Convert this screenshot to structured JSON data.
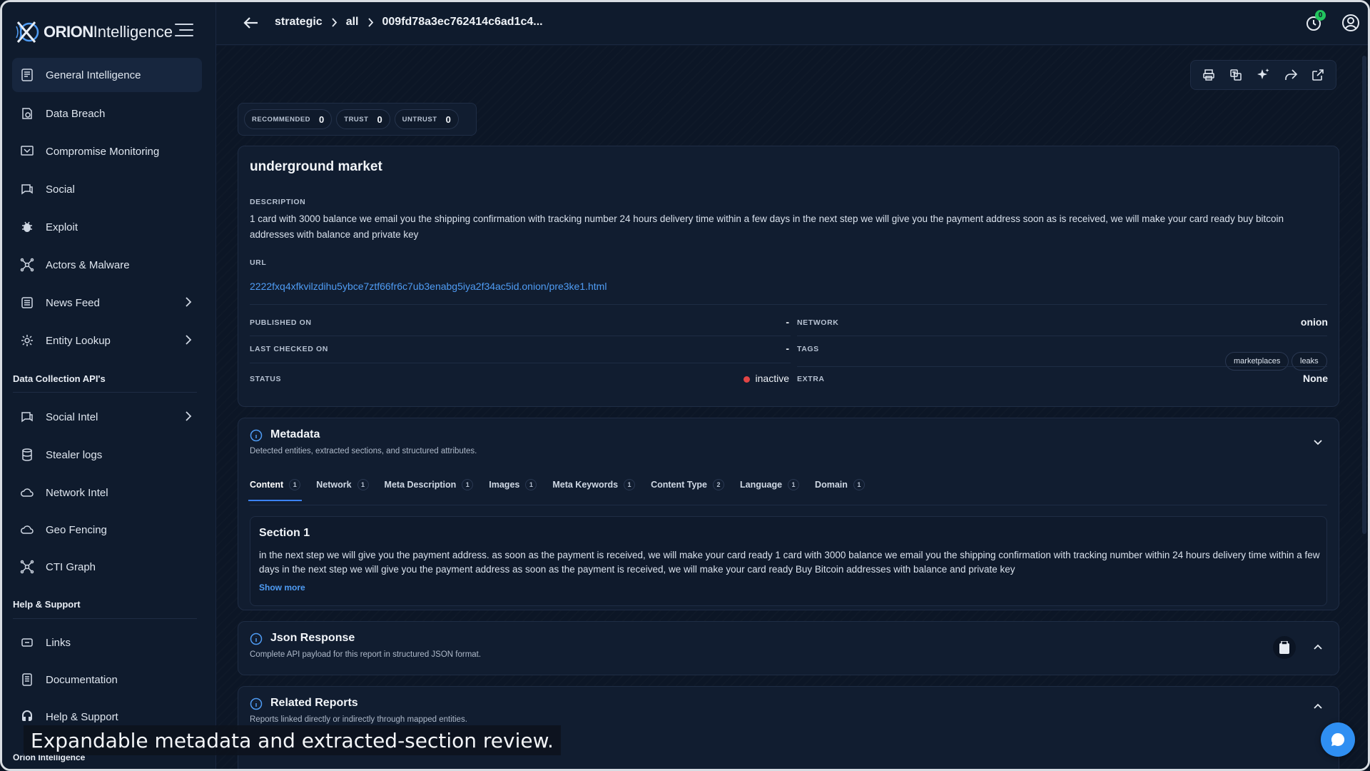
{
  "brand": {
    "bold": "ORION",
    "light": "Intelligence"
  },
  "sidebar": {
    "items": [
      {
        "label": "General Intelligence",
        "icon": "news-icon",
        "active": true
      },
      {
        "label": "Data Breach",
        "icon": "breach-icon"
      },
      {
        "label": "Compromise Monitoring",
        "icon": "monitor-icon"
      },
      {
        "label": "Social",
        "icon": "chat-icon"
      },
      {
        "label": "Exploit",
        "icon": "bug-icon"
      },
      {
        "label": "Actors & Malware",
        "icon": "network-icon"
      },
      {
        "label": "News Feed",
        "icon": "newspaper-icon",
        "expandable": true
      },
      {
        "label": "Entity Lookup",
        "icon": "gear-icon",
        "expandable": true
      }
    ],
    "section_api": "Data Collection API's",
    "api_items": [
      {
        "label": "Social Intel",
        "icon": "chat-icon",
        "expandable": true
      },
      {
        "label": "Stealer logs",
        "icon": "database-icon"
      },
      {
        "label": "Network Intel",
        "icon": "cloud-icon"
      },
      {
        "label": "Geo Fencing",
        "icon": "cloud-icon"
      },
      {
        "label": "CTI Graph",
        "icon": "graph-icon"
      }
    ],
    "section_help": "Help & Support",
    "help_items": [
      {
        "label": "Links",
        "icon": "link-icon"
      },
      {
        "label": "Documentation",
        "icon": "document-icon"
      },
      {
        "label": "Help & Support",
        "icon": "support-icon"
      }
    ],
    "footer": "Orion Intelligence"
  },
  "topbar": {
    "breadcrumbs": [
      "strategic",
      "all",
      "009fd78a3ec762414c6ad1c4..."
    ],
    "notification_count": "0"
  },
  "stats": [
    {
      "label": "RECOMMENDED",
      "value": "0"
    },
    {
      "label": "TRUST",
      "value": "0"
    },
    {
      "label": "UNTRUST",
      "value": "0"
    }
  ],
  "report": {
    "title": "underground market",
    "description_label": "DESCRIPTION",
    "description": "1 card with 3000 balance we email you the shipping confirmation with tracking number 24 hours delivery time within a few days in the next step we will give you the payment address soon as is received, we will make your card ready buy bitcoin addresses with balance and private key",
    "url_label": "URL",
    "url": "2222fxq4xfkvilzdihu5ybce7ztf66fr6c7ub3enabg5iya2f34ac5id.onion/pre3ke1.html",
    "published_label": "PUBLISHED ON",
    "published": "-",
    "last_checked_label": "LAST CHECKED ON",
    "last_checked": "-",
    "status_label": "STATUS",
    "status": "inactive",
    "status_color": "#e24545",
    "network_label": "NETWORK",
    "network": "onion",
    "tags_label": "TAGS",
    "tags": [
      "marketplaces",
      "leaks"
    ],
    "extra_label": "EXTRA",
    "extra": "None"
  },
  "metadata": {
    "title": "Metadata",
    "subtitle": "Detected entities, extracted sections, and structured attributes.",
    "tabs": [
      {
        "label": "Content",
        "count": "1",
        "active": true
      },
      {
        "label": "Network",
        "count": "1"
      },
      {
        "label": "Meta Description",
        "count": "1"
      },
      {
        "label": "Images",
        "count": "1"
      },
      {
        "label": "Meta Keywords",
        "count": "1"
      },
      {
        "label": "Content Type",
        "count": "2"
      },
      {
        "label": "Language",
        "count": "1"
      },
      {
        "label": "Domain",
        "count": "1"
      }
    ],
    "section_title": "Section 1",
    "section_text": "in the next step we will give you the payment address. as soon as the payment is received, we will make your card ready 1 card with 3000 balance we email you the shipping confirmation with tracking number within 24 hours delivery time within a few days in the next step we will give you the payment address as soon as the payment is received, we will make your card ready Buy Bitcoin addresses with balance and private key",
    "show_more": "Show more"
  },
  "json_response": {
    "title": "Json Response",
    "subtitle": "Complete API payload for this report in structured JSON format."
  },
  "related_reports": {
    "title": "Related Reports",
    "subtitle": "Reports linked directly or indirectly through mapped entities."
  },
  "caption": "Expandable metadata and extracted-section review.",
  "colors": {
    "accent": "#3b82f6",
    "link": "#4f9cf4",
    "badge": "#22c55e",
    "fab": "#2f8ff2"
  }
}
